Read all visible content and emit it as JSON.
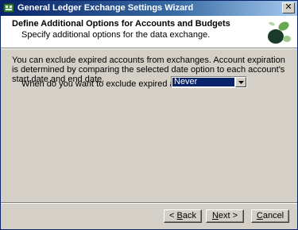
{
  "window": {
    "title": "General Ledger Exchange Settings Wizard",
    "close_glyph": "✕"
  },
  "header": {
    "title": "Define Additional Options for Accounts and Budgets",
    "subtitle": "Specify additional options for the data exchange."
  },
  "body": {
    "description": "You can exclude expired accounts from exchanges. Account expiration is determined by comparing the selected date option to each account's start date and end date.",
    "question": "When do you want to exclude expired accounts?",
    "expire_select": {
      "value": "Never"
    }
  },
  "buttons": {
    "back": {
      "accel": "B",
      "rest": "ack",
      "prefix": "< "
    },
    "next": {
      "prefix": "",
      "accel": "N",
      "rest": "ext >"
    },
    "cancel": {
      "accel": "C",
      "rest": "ancel"
    }
  },
  "icons": {
    "app": "ledger-app-icon",
    "logo": "wizard-logo-icon"
  },
  "colors": {
    "titlebar_start": "#0a246a",
    "titlebar_end": "#a6caf0",
    "selection": "#0a246a",
    "logo_green": "#6aa84f",
    "logo_dark": "#1a3a2a"
  }
}
